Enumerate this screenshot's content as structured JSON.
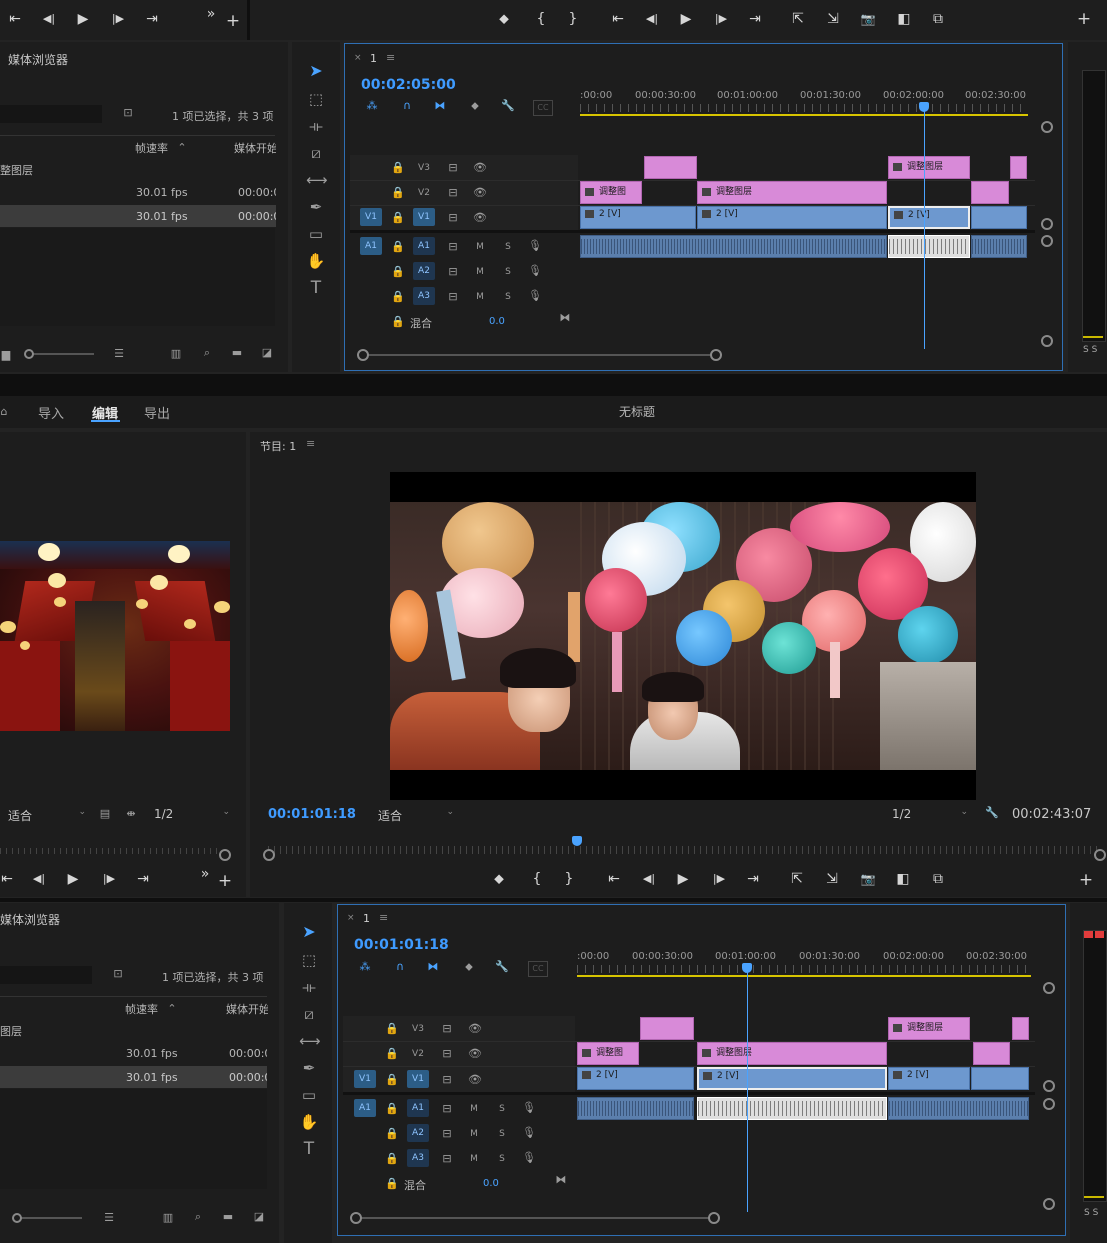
{
  "transport_icons": {
    "step_back_edit": "⇤",
    "step_back": "◀|",
    "play": "▶",
    "step_fwd": "|▶",
    "step_fwd_edit": "⇥",
    "more": "»",
    "add": "+",
    "marker": "⬥",
    "in": "{",
    "out": "}",
    "lift": "⇱",
    "extract": "⇲",
    "export_frame": "📷",
    "compare": "◧",
    "safe": "⧉"
  },
  "top": {
    "media_browser": {
      "title": "媒体浏览器",
      "status": "1 项已选择，共 3 项",
      "col_framerate": "帧速率",
      "col_mediastart": "媒体开始",
      "rows": [
        {
          "name": "整图层",
          "fps": "",
          "start": ""
        },
        {
          "name": "",
          "fps": "30.01 fps",
          "start": "00:00:00"
        },
        {
          "name": "",
          "fps": "30.01 fps",
          "start": "00:00:00"
        }
      ]
    },
    "timeline": {
      "tab": "1",
      "timecode": "00:02:05:00",
      "ruler": [
        ":00:00",
        "00:00:30:00",
        "00:01:00:00",
        "00:01:30:00",
        "00:02:00:00",
        "00:02:30:00"
      ],
      "tracks_video": [
        {
          "id": "V3",
          "src": ""
        },
        {
          "id": "V2",
          "src": ""
        },
        {
          "id": "V1",
          "src": "V1"
        }
      ],
      "tracks_audio": [
        {
          "id": "A1",
          "src": "A1",
          "m": "M",
          "s": "S"
        },
        {
          "id": "A2",
          "src": "",
          "m": "M",
          "s": "S"
        },
        {
          "id": "A3",
          "src": "",
          "m": "M",
          "s": "S"
        }
      ],
      "mix_label": "混合",
      "mix_value": "0.0",
      "clip_adjust_short": "调整图",
      "clip_adjust": "调整图层",
      "clip_video": "2 [V]"
    }
  },
  "workspace": {
    "tabs": [
      "导入",
      "编辑",
      "导出"
    ],
    "active": "编辑",
    "doc_title": "无标题"
  },
  "source_monitor": {
    "fit": "适合",
    "quality": "1/2"
  },
  "program_monitor": {
    "tab": "节目: 1",
    "timecode": "00:01:01:18",
    "fit": "适合",
    "quality": "1/2",
    "duration": "00:02:43:07"
  },
  "bottom": {
    "media_browser": {
      "title": "媒体浏览器",
      "status": "1 项已选择，共 3 项",
      "col_framerate": "帧速率",
      "col_mediastart": "媒体开始",
      "rows": [
        {
          "name": "图层",
          "fps": "",
          "start": ""
        },
        {
          "name": "",
          "fps": "30.01 fps",
          "start": "00:00:00"
        },
        {
          "name": "",
          "fps": "30.01 fps",
          "start": "00:00:00"
        }
      ]
    },
    "timeline": {
      "tab": "1",
      "timecode": "00:01:01:18",
      "ruler": [
        ":00:00",
        "00:00:30:00",
        "00:01:00:00",
        "00:01:30:00",
        "00:02:00:00",
        "00:02:30:00"
      ],
      "mix_label": "混合",
      "mix_value": "0.0",
      "clip_adjust_short": "调整图",
      "clip_adjust": "调整图层",
      "clip_video": "2 [V]"
    }
  },
  "meter_label": "S S"
}
